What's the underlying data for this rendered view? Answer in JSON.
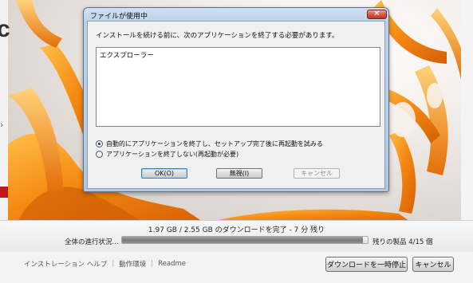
{
  "installer": {
    "logo_fragment": "c",
    "download_status": "1.97 GB / 2.55 GB のダウンロードを完了 - 7 分 残り",
    "overall_progress_label": "全体の進行状況...",
    "progress": 0.98,
    "remaining_products": "残りの製品 4/15 個",
    "footer_links": [
      "インストレーション ヘルプ",
      "動作環境",
      "Readme"
    ],
    "pause_label": "ダウンロードを一時停止",
    "cancel_label": "キャンセル"
  },
  "dialog": {
    "title": "ファイルが使用中",
    "message": "インストールを続ける前に、次のアプリケーションを終了する必要があります。",
    "applications": [
      "エクスプローラー"
    ],
    "options": [
      {
        "label": "自動的にアプリケーションを終了し、セットアップ完了後に再起動を試みる",
        "checked": true
      },
      {
        "label": "アプリケーションを終了しない(再起動が必要)",
        "checked": false
      }
    ],
    "ok_label": "OK(O)",
    "ignore_label": "無視(I)",
    "cancel_label": "キャンセル",
    "close_glyph": "✕"
  },
  "colors": {
    "accent_orange": "#f08a1c",
    "title_bar_blue": "#bad0e8",
    "close_red": "#d55a42",
    "brand_red": "#c4161c"
  }
}
